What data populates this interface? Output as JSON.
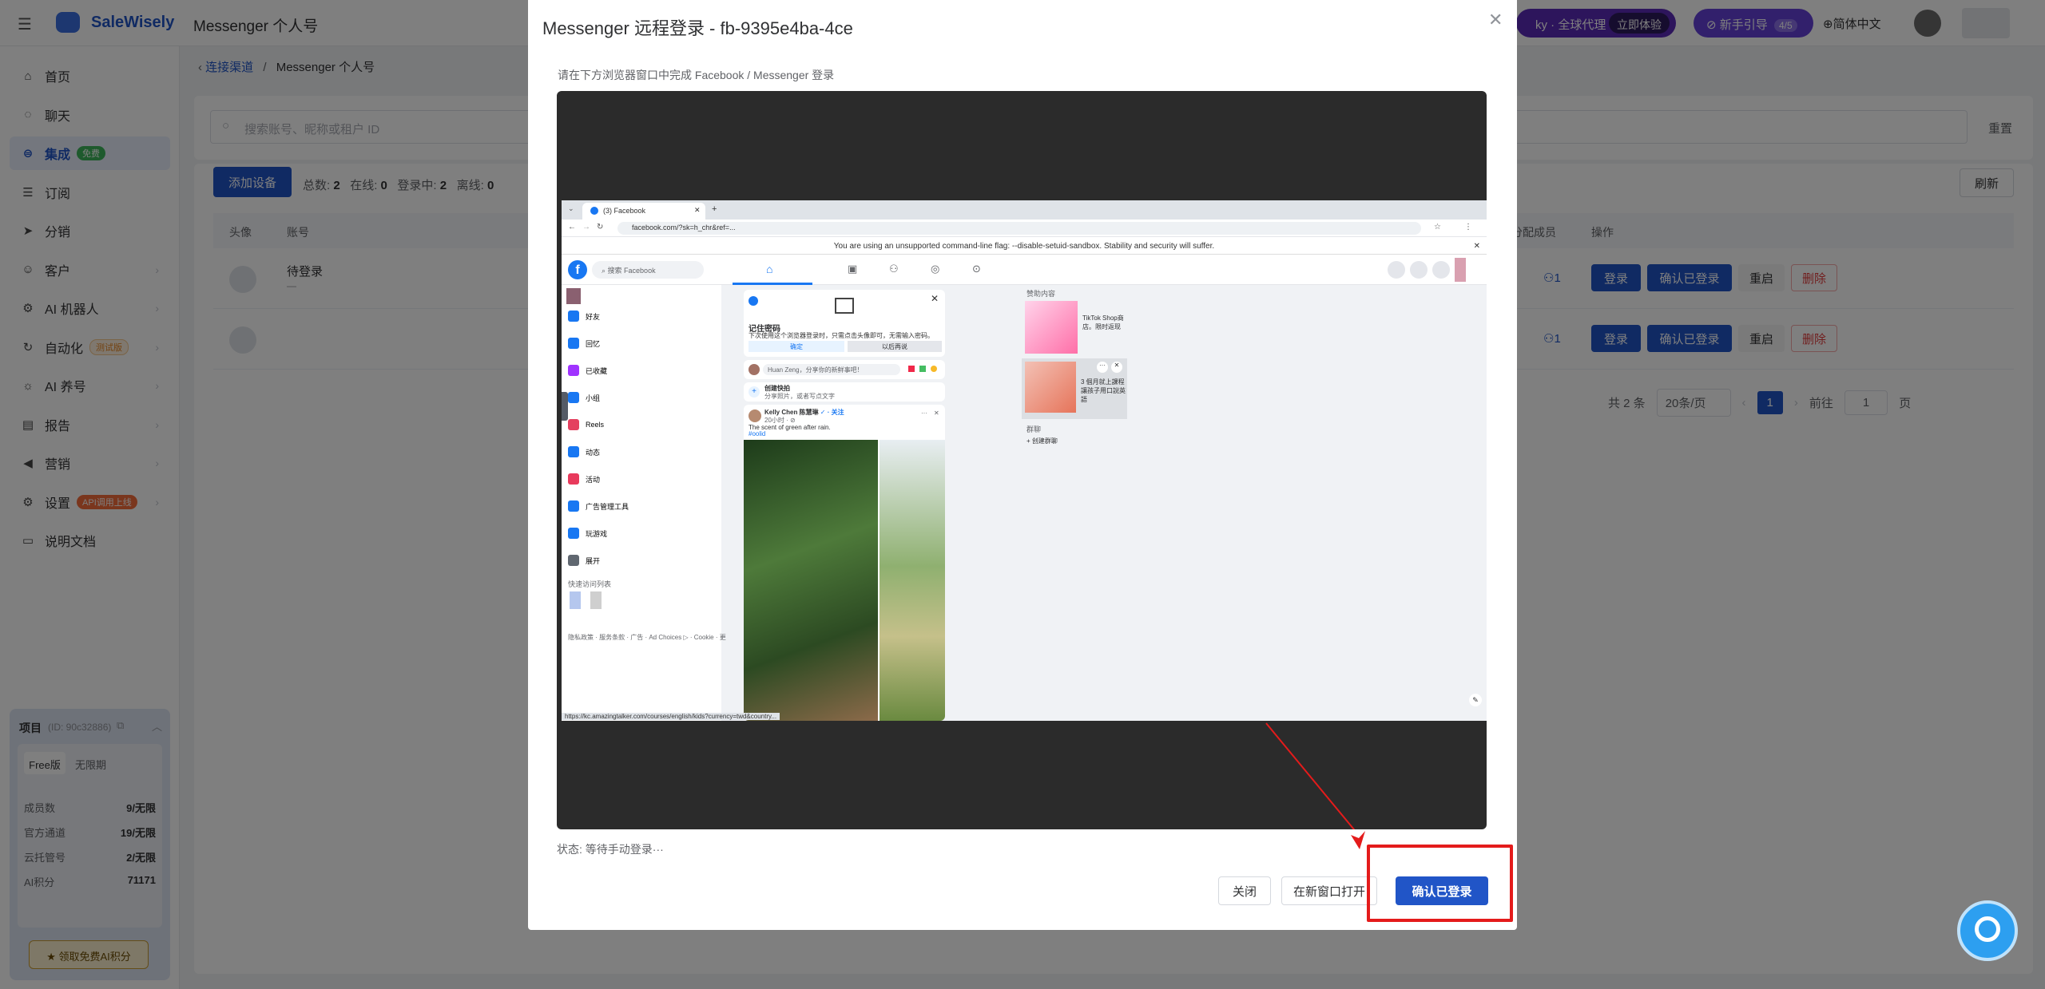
{
  "app": {
    "brand": "SaleWisely",
    "page_title": "Messenger 个人号",
    "promo_text": "ky · 全球代理",
    "promo_button": "立即体验",
    "guide_label": "新手引导",
    "guide_progress": "4/5",
    "language": "简体中文"
  },
  "sidebar": {
    "items": [
      {
        "label": "首页",
        "icon": "home-icon"
      },
      {
        "label": "聊天",
        "icon": "chat-icon"
      },
      {
        "label": "集成",
        "icon": "integration-icon",
        "tag": "免费"
      },
      {
        "label": "订阅",
        "icon": "database-icon"
      },
      {
        "label": "分销",
        "icon": "send-icon"
      },
      {
        "label": "客户",
        "icon": "user-icon"
      },
      {
        "label": "AI 机器人",
        "icon": "robot-icon"
      },
      {
        "label": "自动化",
        "icon": "automation-icon",
        "tag": "测试版"
      },
      {
        "label": "AI 养号",
        "icon": "sun-icon"
      },
      {
        "label": "报告",
        "icon": "report-icon"
      },
      {
        "label": "营销",
        "icon": "megaphone-icon"
      },
      {
        "label": "设置",
        "icon": "gear-icon",
        "tag": "API调用上线"
      },
      {
        "label": "说明文档",
        "icon": "doc-icon"
      }
    ],
    "project": {
      "title": "项目",
      "id_text": "(ID: 90c32886)",
      "plan": "Free版",
      "period": "无限期",
      "stats": [
        {
          "label": "成员数",
          "value": "9/无限"
        },
        {
          "label": "官方通道",
          "value": "19/无限"
        },
        {
          "label": "云托管号",
          "value": "2/无限"
        },
        {
          "label": "AI积分",
          "value": "71171"
        }
      ],
      "cta": "领取免费AI积分"
    }
  },
  "breadcrumb": {
    "parent": "连接渠道",
    "separator": "/",
    "current": "Messenger 个人号"
  },
  "toolbar": {
    "search_placeholder": "搜索账号、昵称或租户 ID",
    "reset": "重置",
    "add_device": "添加设备",
    "total_label": "总数:",
    "total": "2",
    "online_label": "在线:",
    "online": "0",
    "logging_label": "登录中:",
    "logging": "2",
    "offline_label": "离线:",
    "offline": "0",
    "refresh": "刷新"
  },
  "table": {
    "headers": {
      "avatar": "头像",
      "account": "账号",
      "assigned": "分配成员",
      "actions": "操作"
    },
    "rows": [
      {
        "status": "待登录",
        "sub": "—",
        "assigned": "1"
      },
      {
        "status": "",
        "sub": "",
        "assigned": "1"
      }
    ],
    "row_actions": {
      "login": "登录",
      "confirm": "确认已登录",
      "restart": "重启",
      "delete": "删除"
    }
  },
  "pagination": {
    "total_text": "共 2 条",
    "page_size": "20条/页",
    "current": "1",
    "goto_label": "前往",
    "goto_value": "1",
    "page_suffix": "页"
  },
  "modal": {
    "title": "Messenger 远程登录 - fb-9395e4ba-4ce",
    "hint": "请在下方浏览器窗口中完成 Facebook / Messenger 登录",
    "status": "状态: 等待手动登录···",
    "close": "关闭",
    "open_new": "在新窗口打开",
    "confirm": "确认已登录",
    "highlight_color": "#e41b1b"
  },
  "browser": {
    "tab_title": "(3) Facebook",
    "url": "facebook.com/?sk=h_chr&ref=...",
    "warning": "You are using an unsupported command-line flag: --disable-setuid-sandbox. Stability and security will suffer.",
    "fb_search": "搜索 Facebook",
    "left_menu": [
      "好友",
      "回忆",
      "已收藏",
      "小组",
      "Reels",
      "动态",
      "活动",
      "广告管理工具",
      "玩游戏",
      "展开"
    ],
    "left_colors": [
      "#1877f2",
      "#1877f2",
      "#a033ff",
      "#1877f2",
      "#e4405f",
      "#1877f2",
      "#e83a5c",
      "#1877f2",
      "#1877f2",
      "#606770"
    ],
    "shortcuts_title": "快速访问列表",
    "footer_links": "隐私政策 · 服务条款 · 广告 · Ad Choices ▷ · Cookie · 更",
    "save_pw_title": "记住密码",
    "save_pw_desc": "下次使用这个浏览器登录时，只需点击头像即可，无需输入密码。",
    "save_pw_ok": "确定",
    "save_pw_later": "以后再说",
    "composer": "Huan Zeng，分享你的新鲜事吧！",
    "create_story": "创建快拍",
    "create_story_sub": "分享照片，或者写点文字",
    "post_author": "Kelly Chen 陈慧琳",
    "post_follow": "· 关注",
    "post_time": "20小时 · ⊘",
    "post_text": "The scent of green after rain.",
    "post_tag": "#oolid",
    "sponsored": "赞助内容",
    "ad1_title": "TikTok Shop商店。限时返现",
    "ad1_url": "https://www.worldfirst.com.cn/tiktokcrossborder/",
    "ad2_title": "3 個月就上課程 讓孩子用口說英語",
    "ad2_url": "kc.amazingtalker.com",
    "groups": "群聊",
    "create_group": "创建群聊",
    "status_url": "https://kc.amazingtalker.com/courses/english/kids?currency=twd&country..."
  }
}
